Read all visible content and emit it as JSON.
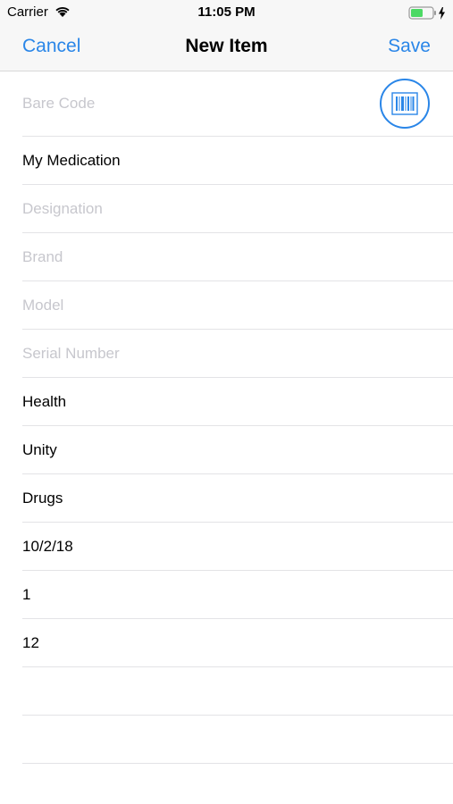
{
  "status_bar": {
    "carrier": "Carrier",
    "time": "11:05 PM",
    "wifi_icon": "wifi-icon",
    "battery_icon": "battery-charging-icon",
    "battery_color": "#4cd964"
  },
  "nav": {
    "cancel_label": "Cancel",
    "title": "New Item",
    "save_label": "Save",
    "accent_color": "#2a86e8"
  },
  "form": {
    "barcode": {
      "value": "",
      "placeholder": "Bare Code"
    },
    "barcode_button_icon": "barcode-icon",
    "name": {
      "value": "My Medication"
    },
    "designation": {
      "value": "",
      "placeholder": "Designation"
    },
    "brand": {
      "value": "",
      "placeholder": "Brand"
    },
    "model": {
      "value": "",
      "placeholder": "Model"
    },
    "serial": {
      "value": "",
      "placeholder": "Serial Number"
    },
    "category": {
      "value": "Health"
    },
    "unit": {
      "value": "Unity"
    },
    "type": {
      "value": "Drugs"
    },
    "date": {
      "value": "10/2/18"
    },
    "quantity": {
      "value": "1"
    },
    "count": {
      "value": "12"
    },
    "extra1": {
      "value": ""
    },
    "extra2": {
      "value": ""
    }
  }
}
